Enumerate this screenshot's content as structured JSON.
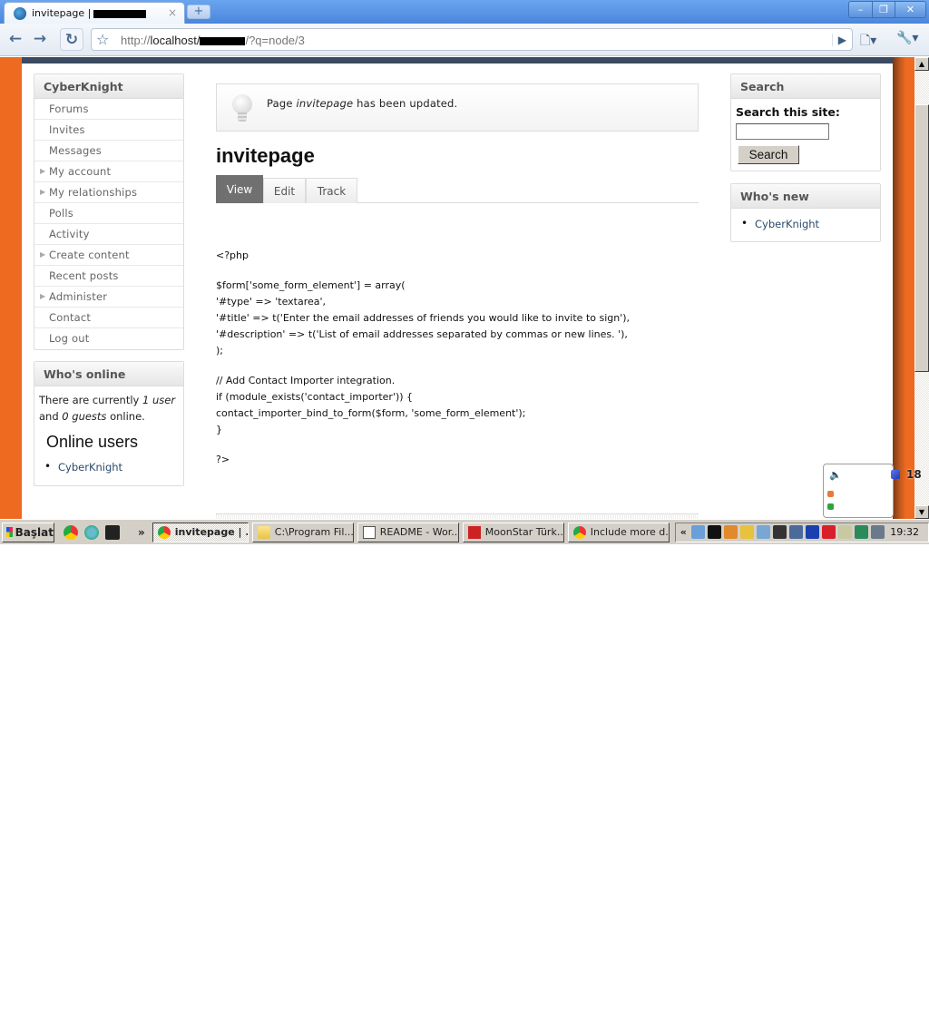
{
  "browser": {
    "tab_title": "invitepage |",
    "tab_close": "×",
    "new_tab": "+",
    "window_controls": {
      "minimize": "–",
      "restore": "❐",
      "close": "✕"
    },
    "back": "←",
    "forward": "→",
    "reload": "↻",
    "star": "☆",
    "url_prefix": "http://",
    "url_host": "localhost/",
    "url_suffix": "/?q=node/3",
    "go": "▶",
    "page_menu": "🗋▾",
    "wrench_menu": "🔧▾"
  },
  "left_nav": {
    "title": "CyberKnight",
    "items": [
      {
        "label": "Forums",
        "expandable": false
      },
      {
        "label": "Invites",
        "expandable": false
      },
      {
        "label": "Messages",
        "expandable": false
      },
      {
        "label": "My account",
        "expandable": true
      },
      {
        "label": "My relationships",
        "expandable": true
      },
      {
        "label": "Polls",
        "expandable": false
      },
      {
        "label": "Activity",
        "expandable": false
      },
      {
        "label": "Create content",
        "expandable": true
      },
      {
        "label": "Recent posts",
        "expandable": false
      },
      {
        "label": "Administer",
        "expandable": true
      },
      {
        "label": "Contact",
        "expandable": false
      },
      {
        "label": "Log out",
        "expandable": false
      }
    ],
    "arrow": "▶"
  },
  "whos_online": {
    "title": "Who's online",
    "text_1": "There are currently ",
    "users": "1 user",
    "text_2": " and ",
    "guests": "0 guests",
    "text_3": " online.",
    "heading": "Online users",
    "list": [
      "CyberKnight"
    ]
  },
  "main": {
    "message_prefix": "Page ",
    "message_page": "invitepage",
    "message_suffix": " has been updated.",
    "title": "invitepage",
    "tabs": [
      {
        "label": "View",
        "active": true
      },
      {
        "label": "Edit",
        "active": false
      },
      {
        "label": "Track",
        "active": false
      }
    ],
    "code_blocks": [
      [
        "<?php"
      ],
      [
        "$form['some_form_element'] = array(",
        "'#type' => 'textarea',",
        "'#title' => t('Enter the email addresses of friends you would like to invite to sign'),",
        "'#description' => t('List of email addresses separated by commas or new lines. '),",
        ");"
      ],
      [
        "// Add Contact Importer integration.",
        "if (module_exists('contact_importer')) {",
        "contact_importer_bind_to_form($form, 'some_form_element');",
        "}"
      ],
      [
        "?>"
      ]
    ]
  },
  "search_block": {
    "title": "Search",
    "label": "Search this site:",
    "input_value": "",
    "button": "Search"
  },
  "whos_new": {
    "title": "Who's new",
    "list": [
      "CyberKnight"
    ]
  },
  "scrollbar": {
    "up": "▲",
    "down": "▼",
    "position_fraction": 0.2
  },
  "widget": {
    "speaker": "🔈",
    "count": "18"
  },
  "taskbar": {
    "start": "Başlat",
    "quicklaunch_more": "»",
    "tasks": [
      {
        "label": "invitepage | ...",
        "icon": "chrome",
        "active": true
      },
      {
        "label": "C:\\Program Fil...",
        "icon": "folder",
        "active": false
      },
      {
        "label": "README - Wor...",
        "icon": "notepad",
        "active": false
      },
      {
        "label": "MoonStar Türk...",
        "icon": "moonstar",
        "active": false
      },
      {
        "label": "Include more d...",
        "icon": "chrome",
        "active": false
      }
    ],
    "tray_chevron": "«",
    "tray_icons": [
      {
        "name": "network-disconnected-icon",
        "color": "#6a9fd8"
      },
      {
        "name": "console-icon",
        "color": "#111111"
      },
      {
        "name": "java-icon",
        "color": "#e08a2c"
      },
      {
        "name": "security-shield-icon",
        "color": "#e8c23a"
      },
      {
        "name": "user-status-icon",
        "color": "#7aa6d6"
      },
      {
        "name": "temperature-icon",
        "color": "#333333"
      },
      {
        "name": "wireless-icon",
        "color": "#4a6a9a"
      },
      {
        "name": "bluetooth-icon",
        "color": "#1a3fb0"
      },
      {
        "name": "antivirus-icon",
        "color": "#d8202a"
      },
      {
        "name": "usb-device-icon",
        "color": "#c9c9a0"
      },
      {
        "name": "display-icon",
        "color": "#2a8a5a"
      },
      {
        "name": "monitor-icon",
        "color": "#6a7a8a"
      }
    ],
    "clock": "19:32"
  }
}
